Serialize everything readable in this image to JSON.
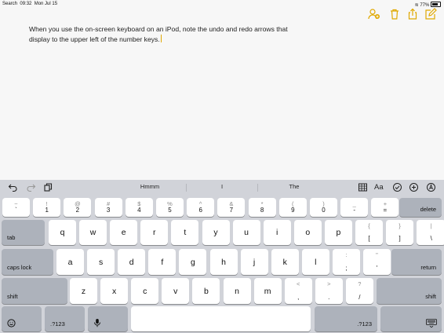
{
  "status_bar": {
    "carrier": "Search",
    "time": "09:32",
    "date": "Mon Jul 15",
    "battery": "77%"
  },
  "toolbar": {
    "icons": [
      "add-person-icon",
      "trash-icon",
      "share-icon",
      "compose-icon"
    ],
    "accent_color": "#e0a800"
  },
  "note": {
    "line1": "When you use the on-screen keyboard on an iPod, note the undo and redo arrows that",
    "line2": "display to the upper left of the number keys."
  },
  "quicktype": {
    "left_icons": [
      "undo-icon",
      "redo-icon",
      "paste-icon"
    ],
    "suggestions": [
      "Hmmm",
      "I",
      "The"
    ],
    "right_icons": [
      "table-icon",
      "format-text-icon",
      "checklist-icon",
      "add-icon",
      "markup-icon"
    ],
    "format_label": "Aa"
  },
  "keyboard": {
    "number_row": [
      {
        "top": "~",
        "bottom": "`"
      },
      {
        "top": "!",
        "bottom": "1"
      },
      {
        "top": "@",
        "bottom": "2"
      },
      {
        "top": "#",
        "bottom": "3"
      },
      {
        "top": "$",
        "bottom": "4"
      },
      {
        "top": "%",
        "bottom": "5"
      },
      {
        "top": "^",
        "bottom": "6"
      },
      {
        "top": "&",
        "bottom": "7"
      },
      {
        "top": "*",
        "bottom": "8"
      },
      {
        "top": "(",
        "bottom": "9"
      },
      {
        "top": ")",
        "bottom": "0"
      },
      {
        "top": "_",
        "bottom": "-"
      },
      {
        "top": "+",
        "bottom": "="
      }
    ],
    "delete": "delete",
    "tab": "tab",
    "row_q": [
      "q",
      "w",
      "e",
      "r",
      "t",
      "y",
      "u",
      "i",
      "o",
      "p"
    ],
    "row_q_extra": [
      {
        "top": "{",
        "bottom": "["
      },
      {
        "top": "}",
        "bottom": "]"
      },
      {
        "top": "|",
        "bottom": "\\"
      }
    ],
    "caps_lock": "caps lock",
    "row_a": [
      "a",
      "s",
      "d",
      "f",
      "g",
      "h",
      "j",
      "k",
      "l"
    ],
    "row_a_extra": [
      {
        "top": ":",
        "bottom": ";"
      },
      {
        "top": "\"",
        "bottom": "'"
      }
    ],
    "return": "return",
    "shift_left": "shift",
    "row_z": [
      "z",
      "x",
      "c",
      "v",
      "b",
      "n",
      "m"
    ],
    "row_z_extra": [
      {
        "top": "<",
        "bottom": ","
      },
      {
        "top": ">",
        "bottom": "."
      },
      {
        "top": "?",
        "bottom": "/"
      }
    ],
    "shift_right": "shift",
    "numbers_left": ".?123",
    "numbers_right": ".?123"
  }
}
